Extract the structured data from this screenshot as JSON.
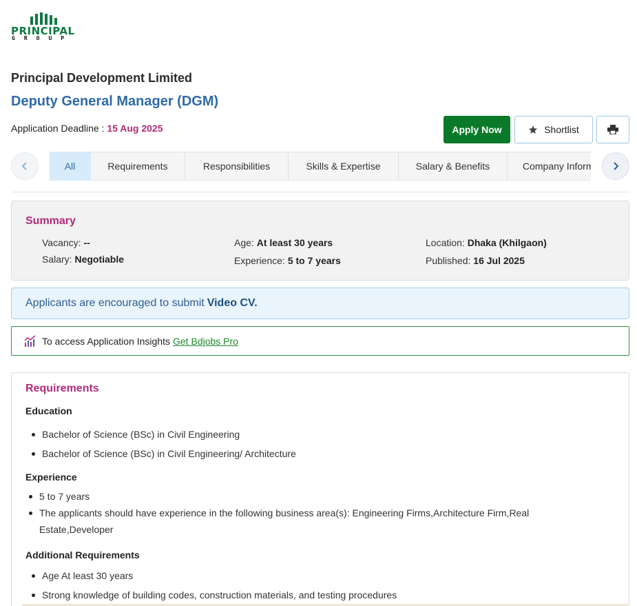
{
  "logo": {
    "word": "PRINCIPAL",
    "sub": "GROUP"
  },
  "company_name": "Principal Development Limited",
  "job_title": "Deputy General Manager (DGM)",
  "deadline": {
    "label": "Application Deadline : ",
    "date": "15 Aug 2025"
  },
  "actions": {
    "apply": "Apply Now",
    "shortlist": "Shortlist"
  },
  "tabs": [
    "All",
    "Requirements",
    "Responsibilities",
    "Skills & Expertise",
    "Salary & Benefits",
    "Company Information"
  ],
  "summary": {
    "title": "Summary",
    "vacancy": {
      "label": "Vacancy: ",
      "value": "--"
    },
    "salary": {
      "label": "Salary: ",
      "value": "Negotiable"
    },
    "age": {
      "label": "Age: ",
      "value": "At least 30 years"
    },
    "experience": {
      "label": "Experience: ",
      "value": "5 to 7 years"
    },
    "location": {
      "label": "Location: ",
      "value": "Dhaka (Khilgaon)"
    },
    "published": {
      "label": "Published: ",
      "value": "16 Jul 2025"
    }
  },
  "video_cv": {
    "text": "Applicants are encouraged to submit",
    "bold": "Video CV."
  },
  "insights": {
    "text": "To access Application Insights",
    "link": "Get Bdjobs Pro"
  },
  "requirements": {
    "title": "Requirements",
    "education_title": "Education",
    "education": [
      "Bachelor of Science (BSc) in Civil Engineering",
      "Bachelor of Science (BSc) in Civil Engineering/ Architecture"
    ],
    "experience_title": "Experience",
    "experience": [
      "5 to 7 years",
      "The applicants should have experience in the following business area(s): Engineering Firms,Architecture Firm,Real",
      "Estate,Developer"
    ],
    "additional_title": "Additional Requirements",
    "additional": [
      "Age At least 30 years",
      "Strong knowledge of building codes, construction materials, and testing procedures"
    ]
  },
  "colors": {
    "brand_green": "#0e7a43",
    "apply_green": "#0a7a2a",
    "title_blue": "#2f6aa8",
    "accent_magenta": "#b12b7a"
  }
}
